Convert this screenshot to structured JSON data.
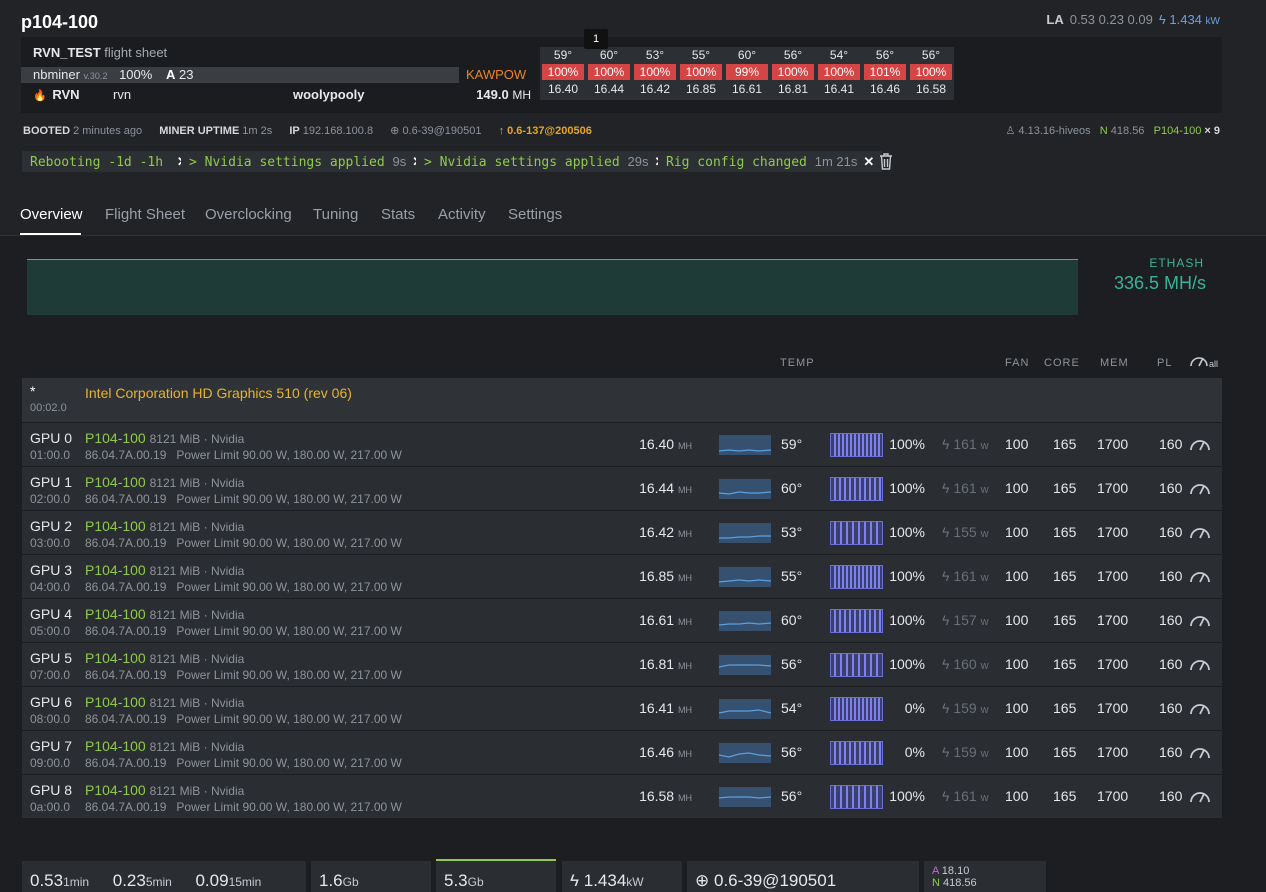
{
  "rig": {
    "name": "p104-100",
    "la_label": "LA",
    "la_values": "0.53 0.23 0.09",
    "power": "1.434",
    "power_unit": "kW"
  },
  "flight_sheet": {
    "name": "RVN_TEST",
    "suffix": "flight sheet",
    "miner": "nbminer",
    "miner_version": "v.30.2",
    "miner_percent": "100%",
    "accepted_label": "A",
    "accepted": "23",
    "algo": "KAWPOW",
    "coin": "RVN",
    "wallet": "rvn",
    "pool": "woolypooly",
    "hashrate": "149.0",
    "hashrate_unit": "MH"
  },
  "tooltip": "1",
  "gpu_summary": [
    {
      "temp": "59°",
      "fan": "100%",
      "hr": "16.40"
    },
    {
      "temp": "60°",
      "fan": "100%",
      "hr": "16.44"
    },
    {
      "temp": "53°",
      "fan": "100%",
      "hr": "16.42"
    },
    {
      "temp": "55°",
      "fan": "100%",
      "hr": "16.85"
    },
    {
      "temp": "60°",
      "fan": "99%",
      "hr": "16.61"
    },
    {
      "temp": "56°",
      "fan": "100%",
      "hr": "16.81"
    },
    {
      "temp": "54°",
      "fan": "100%",
      "hr": "16.41"
    },
    {
      "temp": "56°",
      "fan": "101%",
      "hr": "16.46"
    },
    {
      "temp": "56°",
      "fan": "100%",
      "hr": "16.58"
    }
  ],
  "info": {
    "booted_label": "BOOTED",
    "booted": "2 minutes ago",
    "uptime_label": "MINER UPTIME",
    "uptime": "1m 2s",
    "ip_label": "IP",
    "ip": "192.168.100.8",
    "version": "0.6-39@190501",
    "update": "0.6-137@200506",
    "kernel": "4.13.16-hiveos",
    "nvidia_label": "N",
    "nvidia": "418.56",
    "gpu_model": "P104-100",
    "gpu_count": "× 9"
  },
  "messages": [
    {
      "text": "Rebooting -1d -1h",
      "time": ""
    },
    {
      "text": "> Nvidia settings applied",
      "time": "9s"
    },
    {
      "text": "> Nvidia settings applied",
      "time": "29s"
    },
    {
      "text": "Rig config changed",
      "time": "1m 21s"
    }
  ],
  "close_glyph": "✕",
  "tabs": [
    "Overview",
    "Flight Sheet",
    "Overclocking",
    "Tuning",
    "Stats",
    "Activity",
    "Settings"
  ],
  "algo_summary": {
    "name": "ETHASH",
    "value": "336.5 MH/s"
  },
  "columns": {
    "temp": "TEMP",
    "fan": "FAN",
    "core": "CORE",
    "mem": "MEM",
    "pl": "PL",
    "all": "all"
  },
  "igpu": {
    "star": "*",
    "bus": "00:02.0",
    "name": "Intel Corporation HD Graphics 510 (rev 06)"
  },
  "gpus": [
    {
      "id": "GPU 0",
      "bus": "01:00.0",
      "model": "P104-100",
      "mem": "8121 MiB · Nvidia",
      "bios": "86.04.7A.00.19",
      "plimit": "Power Limit 90.00 W, 180.00 W, 217.00 W",
      "hr": "16.40",
      "temp": "59°",
      "fan": "100%",
      "fan_level": 1.0,
      "power": "161",
      "fanset": "100",
      "core": "165",
      "memclk": "1700",
      "pl": "160"
    },
    {
      "id": "GPU 1",
      "bus": "02:00.0",
      "model": "P104-100",
      "mem": "8121 MiB · Nvidia",
      "bios": "86.04.7A.00.19",
      "plimit": "Power Limit 90.00 W, 180.00 W, 217.00 W",
      "hr": "16.44",
      "temp": "60°",
      "fan": "100%",
      "fan_level": 1.0,
      "power": "161",
      "fanset": "100",
      "core": "165",
      "memclk": "1700",
      "pl": "160"
    },
    {
      "id": "GPU 2",
      "bus": "03:00.0",
      "model": "P104-100",
      "mem": "8121 MiB · Nvidia",
      "bios": "86.04.7A.00.19",
      "plimit": "Power Limit 90.00 W, 180.00 W, 217.00 W",
      "hr": "16.42",
      "temp": "53°",
      "fan": "100%",
      "fan_level": 1.0,
      "power": "155",
      "fanset": "100",
      "core": "165",
      "memclk": "1700",
      "pl": "160"
    },
    {
      "id": "GPU 3",
      "bus": "04:00.0",
      "model": "P104-100",
      "mem": "8121 MiB · Nvidia",
      "bios": "86.04.7A.00.19",
      "plimit": "Power Limit 90.00 W, 180.00 W, 217.00 W",
      "hr": "16.85",
      "temp": "55°",
      "fan": "100%",
      "fan_level": 1.0,
      "power": "161",
      "fanset": "100",
      "core": "165",
      "memclk": "1700",
      "pl": "160"
    },
    {
      "id": "GPU 4",
      "bus": "05:00.0",
      "model": "P104-100",
      "mem": "8121 MiB · Nvidia",
      "bios": "86.04.7A.00.19",
      "plimit": "Power Limit 90.00 W, 180.00 W, 217.00 W",
      "hr": "16.61",
      "temp": "60°",
      "fan": "100%",
      "fan_level": 1.0,
      "power": "157",
      "fanset": "100",
      "core": "165",
      "memclk": "1700",
      "pl": "160"
    },
    {
      "id": "GPU 5",
      "bus": "07:00.0",
      "model": "P104-100",
      "mem": "8121 MiB · Nvidia",
      "bios": "86.04.7A.00.19",
      "plimit": "Power Limit 90.00 W, 180.00 W, 217.00 W",
      "hr": "16.81",
      "temp": "56°",
      "fan": "100%",
      "fan_level": 1.0,
      "power": "160",
      "fanset": "100",
      "core": "165",
      "memclk": "1700",
      "pl": "160"
    },
    {
      "id": "GPU 6",
      "bus": "08:00.0",
      "model": "P104-100",
      "mem": "8121 MiB · Nvidia",
      "bios": "86.04.7A.00.19",
      "plimit": "Power Limit 90.00 W, 180.00 W, 217.00 W",
      "hr": "16.41",
      "temp": "54°",
      "fan": "0%",
      "fan_level": 1.0,
      "power": "159",
      "fanset": "100",
      "core": "165",
      "memclk": "1700",
      "pl": "160"
    },
    {
      "id": "GPU 7",
      "bus": "09:00.0",
      "model": "P104-100",
      "mem": "8121 MiB · Nvidia",
      "bios": "86.04.7A.00.19",
      "plimit": "Power Limit 90.00 W, 180.00 W, 217.00 W",
      "hr": "16.46",
      "temp": "56°",
      "fan": "0%",
      "fan_level": 1.0,
      "power": "159",
      "fanset": "100",
      "core": "165",
      "memclk": "1700",
      "pl": "160"
    },
    {
      "id": "GPU 8",
      "bus": "0a:00.0",
      "model": "P104-100",
      "mem": "8121 MiB · Nvidia",
      "bios": "86.04.7A.00.19",
      "plimit": "Power Limit 90.00 W, 180.00 W, 217.00 W",
      "hr": "16.58",
      "temp": "56°",
      "fan": "100%",
      "fan_level": 1.0,
      "power": "161",
      "fanset": "100",
      "core": "165",
      "memclk": "1700",
      "pl": "160"
    }
  ],
  "units": {
    "mh": "MH",
    "w": "w"
  },
  "bottom": {
    "la1": "0.53",
    "la1_unit": "1min",
    "la5": "0.23",
    "la5_unit": "5min",
    "la15": "0.09",
    "la15_unit": "15min",
    "ram_total": "1.6",
    "ram_total_unit": "Gb",
    "disk": "5.3",
    "disk_unit": "Gb",
    "power": "1.434",
    "power_unit": "kW",
    "version": "0.6-39@190501",
    "amd_label": "A",
    "amd": "18.10",
    "nv_label": "N",
    "nv": "418.56"
  },
  "colors": {
    "accent_green": "#8fcb4a",
    "algo_teal": "#3ab39a",
    "fan_red": "#d64545",
    "kawpow_orange": "#e8862a",
    "intel_yellow": "#e8b42a"
  }
}
